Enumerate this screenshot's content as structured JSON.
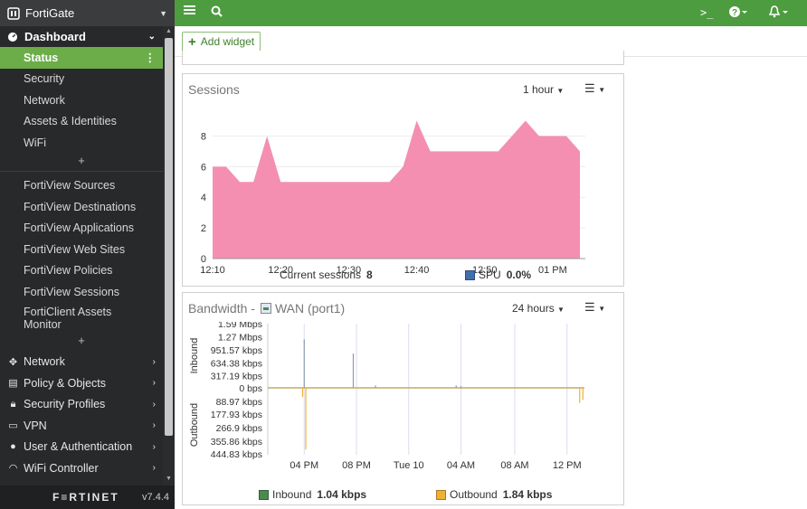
{
  "app": {
    "title": "FortiGate",
    "brand": "F≡RTINET",
    "version": "v7.4.4"
  },
  "sidebar": {
    "dashboard_label": "Dashboard",
    "dashboard_items": [
      {
        "label": "Status",
        "active": true
      },
      {
        "label": "Security"
      },
      {
        "label": "Network"
      },
      {
        "label": "Assets & Identities"
      },
      {
        "label": "WiFi"
      }
    ],
    "fortiview_items": [
      {
        "label": "FortiView Sources"
      },
      {
        "label": "FortiView Destinations"
      },
      {
        "label": "FortiView Applications"
      },
      {
        "label": "FortiView Web Sites"
      },
      {
        "label": "FortiView Policies"
      },
      {
        "label": "FortiView Sessions"
      },
      {
        "label": "FortiClient Assets Monitor"
      }
    ],
    "main_items": [
      {
        "label": "Network",
        "icon": "network-icon"
      },
      {
        "label": "Policy & Objects",
        "icon": "policy-icon"
      },
      {
        "label": "Security Profiles",
        "icon": "lock-icon"
      },
      {
        "label": "VPN",
        "icon": "monitor-icon"
      },
      {
        "label": "User & Authentication",
        "icon": "user-icon"
      },
      {
        "label": "WiFi Controller",
        "icon": "wifi-icon"
      }
    ]
  },
  "toolbar": {
    "add_widget_label": "Add widget"
  },
  "sessions_widget": {
    "title": "Sessions",
    "time_range": "1 hour",
    "legend": {
      "current_label": "Current sessions",
      "current_value": "8",
      "spu_label": "SPU",
      "spu_value": "0.0%"
    },
    "colors": {
      "area": "#f48fb1",
      "spu": "#3f6fae"
    }
  },
  "bandwidth_widget": {
    "title_prefix": "Bandwidth -",
    "interface": "WAN (port1)",
    "time_range": "24 hours",
    "inbound_axis": "Inbound",
    "outbound_axis": "Outbound",
    "legend": {
      "inbound_label": "Inbound",
      "inbound_value": "1.04 kbps",
      "outbound_label": "Outbound",
      "outbound_value": "1.84 kbps"
    },
    "colors": {
      "inbound": "#4c8a50",
      "outbound": "#f0b133"
    }
  },
  "chart_data": [
    {
      "type": "area",
      "x": [
        "12:10",
        "12:12",
        "12:14",
        "12:16",
        "12:18",
        "12:20",
        "12:22",
        "12:24",
        "12:26",
        "12:28",
        "12:30",
        "12:32",
        "12:34",
        "12:36",
        "12:38",
        "12:40",
        "12:42",
        "12:44",
        "12:46",
        "12:48",
        "12:50",
        "12:52",
        "12:54",
        "12:56",
        "12:58",
        "13:00",
        "13:02",
        "13:04"
      ],
      "series": [
        {
          "name": "Current sessions",
          "values": [
            6,
            6,
            5,
            5,
            8,
            5,
            5,
            5,
            5,
            5,
            5,
            5,
            5,
            5,
            6,
            9,
            7,
            7,
            7,
            7,
            7,
            7,
            8,
            9,
            8,
            8,
            8,
            7
          ]
        }
      ],
      "xticks": [
        "12:10",
        "12:20",
        "12:30",
        "12:40",
        "12:50",
        "01 PM"
      ],
      "yticks": [
        "0",
        "2",
        "4",
        "6",
        "8"
      ],
      "ylim": [
        0,
        9.8
      ]
    },
    {
      "type": "line",
      "xticks": [
        "04 PM",
        "08 PM",
        "Tue 10",
        "04 AM",
        "08 AM",
        "12 PM"
      ],
      "inbound_ticks": [
        "1.59 Mbps",
        "1.27 Mbps",
        "951.57 kbps",
        "634.38 kbps",
        "317.19 kbps",
        "0 bps"
      ],
      "outbound_ticks": [
        "88.97 kbps",
        "177.93 kbps",
        "266.9 kbps",
        "355.86 kbps",
        "444.83 kbps"
      ],
      "series": [
        {
          "name": "Inbound",
          "spikes": [
            {
              "pos": 0.115,
              "kbps": 1200
            },
            {
              "pos": 0.27,
              "kbps": 850
            },
            {
              "pos": 0.34,
              "kbps": 60
            },
            {
              "pos": 0.595,
              "kbps": 60
            },
            {
              "pos": 0.61,
              "kbps": 40
            }
          ]
        },
        {
          "name": "Outbound",
          "spikes": [
            {
              "pos": 0.12,
              "kbps": 410
            },
            {
              "pos": 0.11,
              "kbps": 60
            },
            {
              "pos": 0.985,
              "kbps": 100
            },
            {
              "pos": 0.995,
              "kbps": 80
            }
          ]
        }
      ]
    }
  ]
}
